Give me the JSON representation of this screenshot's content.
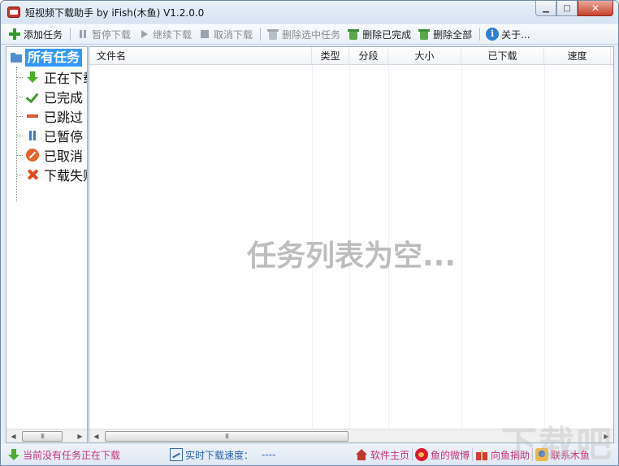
{
  "window": {
    "title": "短视频下载助手 by iFish(木鱼) V1.2.0.0",
    "controls": {
      "minimize": "▁",
      "maximize": "□",
      "close": "✕"
    }
  },
  "toolbar": {
    "add_task": "添加任务",
    "pause_download": "暂停下载",
    "resume_download": "继续下载",
    "cancel_download": "取消下载",
    "delete_selected": "删除选中任务",
    "delete_completed": "删除已完成",
    "delete_all": "删除全部",
    "about": "关于..."
  },
  "sidebar": {
    "root": "所有任务",
    "items": [
      {
        "label": "正在下载",
        "icon": "download-arrow-icon"
      },
      {
        "label": "已完成",
        "icon": "check-icon"
      },
      {
        "label": "已跳过",
        "icon": "minus-icon"
      },
      {
        "label": "已暂停",
        "icon": "pause-icon"
      },
      {
        "label": "已取消",
        "icon": "cancel-icon"
      },
      {
        "label": "下载失败",
        "icon": "x-icon"
      }
    ]
  },
  "table": {
    "columns": [
      "文件名",
      "类型",
      "分段",
      "大小",
      "已下载",
      "速度"
    ],
    "rows": [],
    "empty_message": "任务列表为空..."
  },
  "scrollbars": {
    "thumb_grip": "III",
    "left_arrow": "◀",
    "right_arrow": "▶"
  },
  "statusbar": {
    "status": "当前没有任务正在下载",
    "speed_label": "实时下载速度：",
    "speed_value": "----",
    "links": {
      "homepage": "软件主页",
      "weibo": "鱼的微博",
      "donate": "向鱼捐助",
      "contact": "联系木鱼"
    }
  },
  "watermark": "下载吧",
  "colors": {
    "selection": "#3399ff",
    "status_text": "#c8307a",
    "speed_text": "#2a5fb0",
    "empty_text": "#bdbdbd"
  }
}
